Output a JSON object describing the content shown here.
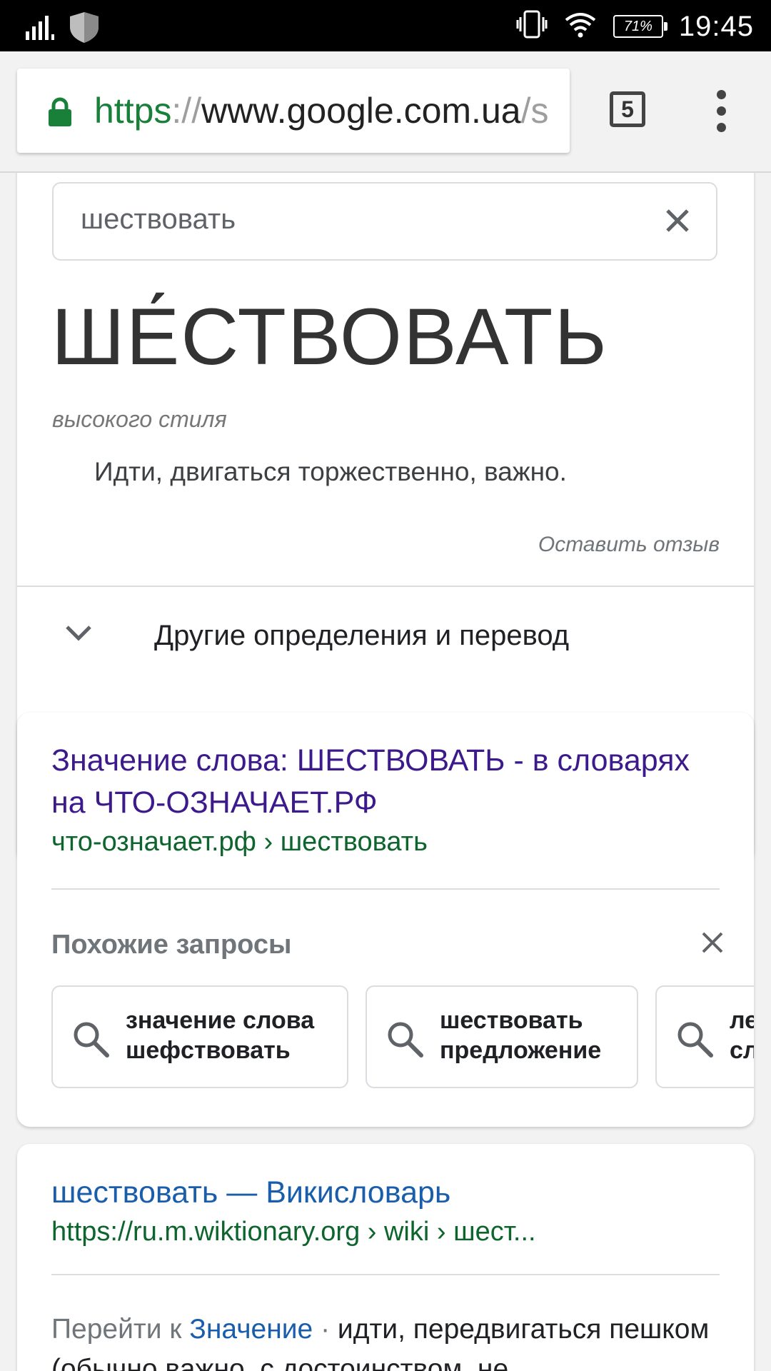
{
  "status_bar": {
    "time": "19:45",
    "battery": "71%",
    "icons": [
      "signal-icon",
      "shield-icon",
      "vibrate-icon",
      "wifi-icon",
      "battery-icon"
    ]
  },
  "browser": {
    "url_scheme": "https",
    "url_sep": "://",
    "url_host": "www.google.com.ua",
    "url_rest": "/s",
    "tab_count": "5"
  },
  "dictionary": {
    "query": "шествовать",
    "headword": "ШЕ́СТВОВАТЬ",
    "style_note": "высокого стиля",
    "definition": "Идти, двигаться торжественно, важно.",
    "feedback": "Оставить отзыв",
    "more_label": "Другие определения и перевод"
  },
  "result1": {
    "title": "Значение слова: ШЕСТВОВАТЬ - в словарях на ЧТО-ОЗНАЧАЕТ.РФ",
    "url": "что-означает.рф › шествовать"
  },
  "related": {
    "heading": "Похожие запросы",
    "chips": [
      "значение слова\nшефствовать",
      "шествовать\nпредложение",
      "ле\nсл"
    ]
  },
  "result2": {
    "title": "шествовать — Викисловарь",
    "url": "https://ru.m.wiktionary.org › wiki › шест...",
    "snippet_prefix": "Перейти к ",
    "snippet_link": "Значение",
    "snippet_dot": " · ",
    "snippet_text": "идти, передвигаться пешком (обычно важно, с достоинством, не"
  },
  "colors": {
    "visited_link": "#3c1a8c",
    "link": "#1a5dab",
    "url_green": "#0d652d",
    "secure_green": "#188038"
  }
}
